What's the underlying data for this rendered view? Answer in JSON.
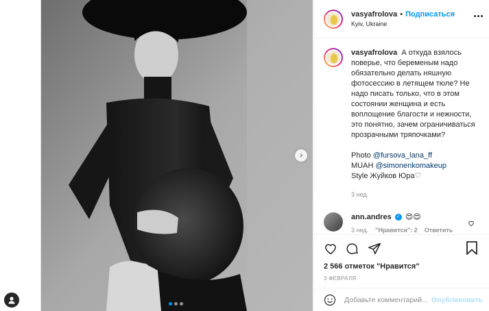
{
  "post": {
    "author": "vasyafrolova",
    "separator": "•",
    "follow_label": "Подписаться",
    "location": "Kyiv, Ukraine"
  },
  "caption": {
    "username": "vasyafrolova",
    "text": "А откуда взялось поверье, что беременым надо обязательно делать няшную фотосессию в летящем тюле? Не надо писать только, что в этом состоянии женщина и есть воплощение благости и нежности, это понятно, зачем ограничиваться прозрачными тряпочками?",
    "photo_prefix": "Photo ",
    "photo_mention": "@fursova_lana_ff",
    "muah_prefix": "MUAH ",
    "muah_mention": "@simonenkomakeup",
    "style_line": "Style Жуйков Юра",
    "style_heart": "♡",
    "time": "3 нед."
  },
  "comment": {
    "username": "ann.andres",
    "verified_mark": "✓",
    "text": "😍😍",
    "time": "3 нед.",
    "likes_label": "\"Нравится\": 2",
    "reply_label": "Ответить"
  },
  "likes_text": "2 566 отметок \"Нравится\"",
  "date_text": "3 ФЕВРАЛЯ",
  "add_comment": {
    "placeholder": "Добавьте комментарий...",
    "publish_label": "Опубликовать"
  },
  "carousel": {
    "count": 3,
    "active_index": 0
  },
  "colors": {
    "accent": "#0095f6",
    "mention": "#00376b",
    "muted": "#8e8e8e",
    "publish_disabled": "#b2dffc"
  }
}
